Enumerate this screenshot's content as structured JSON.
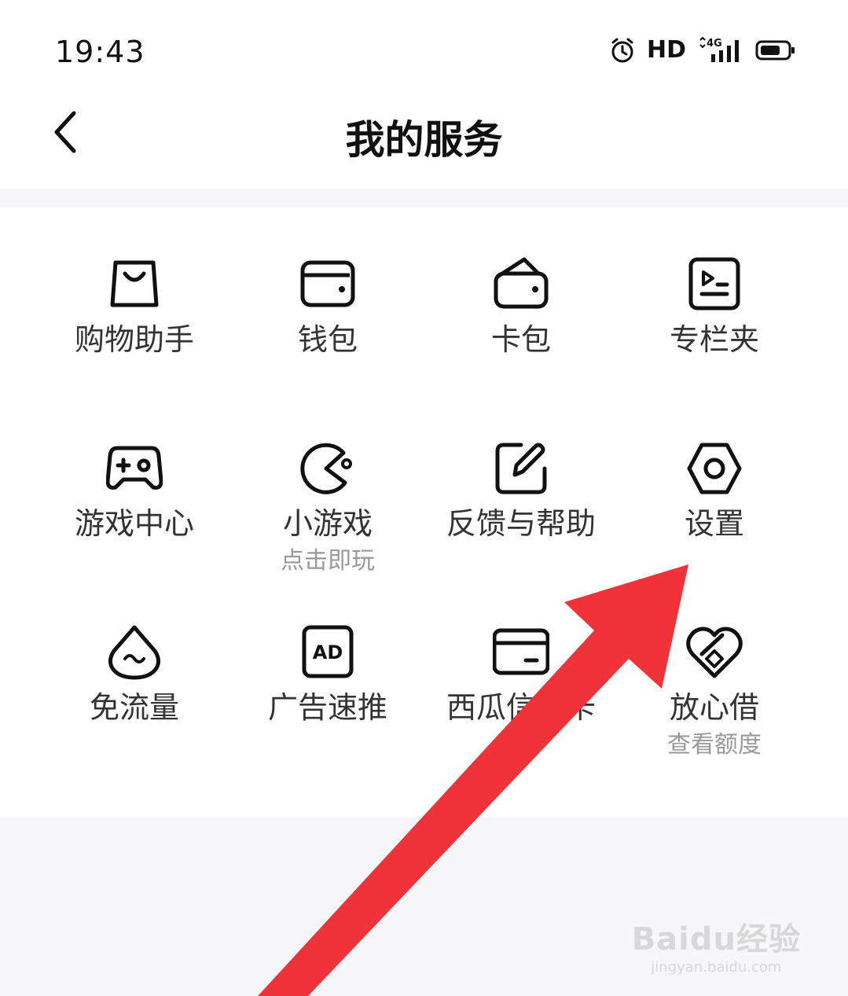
{
  "status_bar": {
    "time": "19:43",
    "hd": "HD",
    "network": "4G"
  },
  "header": {
    "title": "我的服务"
  },
  "services": [
    {
      "label": "购物助手",
      "icon": "shopping-bag-icon"
    },
    {
      "label": "钱包",
      "icon": "wallet-icon"
    },
    {
      "label": "卡包",
      "icon": "card-holder-icon"
    },
    {
      "label": "专栏夹",
      "icon": "column-folder-icon"
    },
    {
      "label": "游戏中心",
      "icon": "gamepad-icon"
    },
    {
      "label": "小游戏",
      "sub": "点击即玩",
      "icon": "pacman-icon"
    },
    {
      "label": "反馈与帮助",
      "icon": "edit-icon"
    },
    {
      "label": "设置",
      "icon": "settings-hexagon-icon"
    },
    {
      "label": "免流量",
      "icon": "water-drop-icon"
    },
    {
      "label": "广告速推",
      "icon": "ad-icon"
    },
    {
      "label": "西瓜信用卡",
      "icon": "credit-card-icon"
    },
    {
      "label": "放心借",
      "sub": "查看额度",
      "icon": "heart-icon"
    }
  ],
  "icons": {
    "ad_text": "AD"
  },
  "annotation": {
    "arrow_color": "#ef3338"
  },
  "watermark": {
    "logo": "Baidu经验",
    "url": "jingyan.baidu.com"
  }
}
